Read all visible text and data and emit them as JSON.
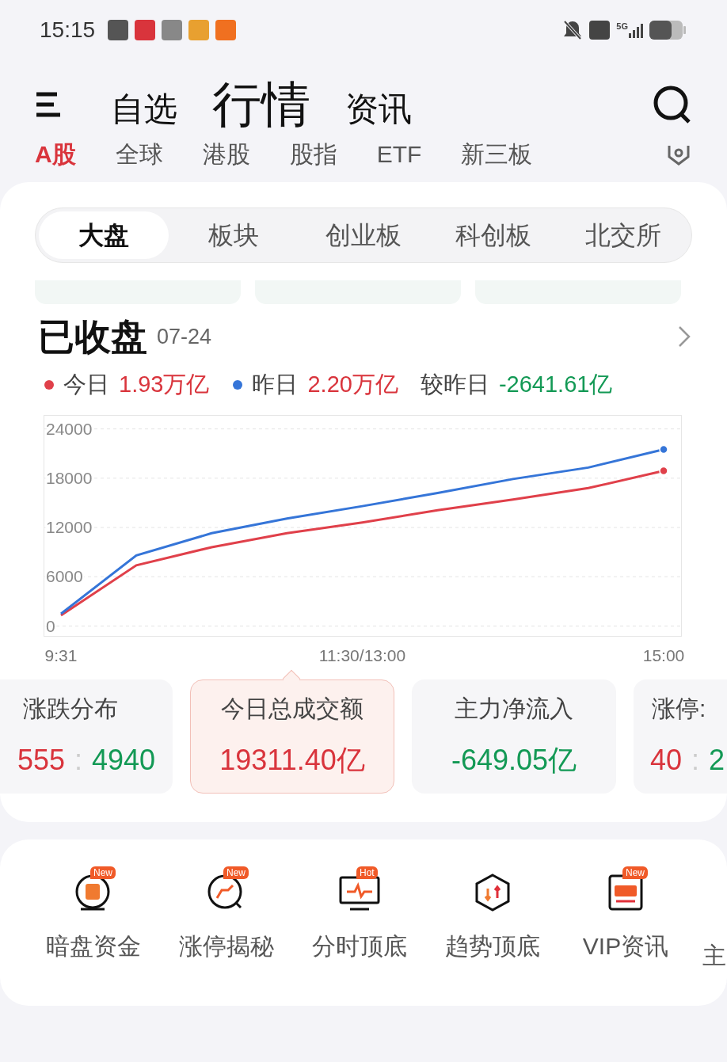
{
  "status_bar": {
    "time": "15:15",
    "network": "5G"
  },
  "top_tabs": [
    {
      "label": "自选",
      "selected": false
    },
    {
      "label": "行情",
      "selected": true
    },
    {
      "label": "资讯",
      "selected": false
    }
  ],
  "market_tabs": [
    {
      "label": "A股",
      "selected": true
    },
    {
      "label": "全球",
      "selected": false
    },
    {
      "label": "港股",
      "selected": false
    },
    {
      "label": "股指",
      "selected": false
    },
    {
      "label": "ETF",
      "selected": false
    },
    {
      "label": "新三板",
      "selected": false
    }
  ],
  "segments": [
    {
      "label": "大盘",
      "selected": true
    },
    {
      "label": "板块",
      "selected": false
    },
    {
      "label": "创业板",
      "selected": false
    },
    {
      "label": "科创板",
      "selected": false
    },
    {
      "label": "北交所",
      "selected": false
    }
  ],
  "summary": {
    "title": "已收盘",
    "date": "07-24",
    "today_value": "1.93万亿",
    "yesterday_value": "2.20万亿",
    "diff_label": "较昨日",
    "diff_value": "-2641.61亿"
  },
  "chart_data": {
    "type": "line",
    "grid": true,
    "categories": [
      "9:31",
      null,
      null,
      null,
      "11:30/13:00",
      null,
      null,
      null,
      "15:00"
    ],
    "ylim": [
      -1300,
      25700
    ],
    "yticks": [
      0,
      6000,
      12000,
      18000,
      24000
    ],
    "series": [
      {
        "name": "今日",
        "color": "#e0404a",
        "values": [
          1300,
          7400,
          9600,
          11300,
          12600,
          14100,
          15400,
          16800,
          18900
        ]
      },
      {
        "name": "昨日",
        "color": "#3575d8",
        "values": [
          1500,
          8600,
          11300,
          13100,
          14600,
          16200,
          17900,
          19300,
          21500
        ]
      }
    ]
  },
  "cards": [
    {
      "title": "涨跌分布",
      "kind": "ratio",
      "up": "555",
      "separator": ":",
      "down": "4940",
      "selected": false
    },
    {
      "title": "今日总成交额",
      "kind": "value",
      "value": "19311.40亿",
      "color": "#d9343c",
      "selected": true
    },
    {
      "title": "主力净流入",
      "kind": "value",
      "value": "-649.05亿",
      "color": "#139955",
      "selected": false
    },
    {
      "title": "涨停:",
      "kind": "ratio",
      "up": "40",
      "separator": ":",
      "down": "2",
      "selected": false
    }
  ],
  "tools": [
    {
      "label": "暗盘资金",
      "badge": "New",
      "kind": "dark"
    },
    {
      "label": "涨停揭秘",
      "badge": "New",
      "kind": "search"
    },
    {
      "label": "分时顶底",
      "badge": "Hot",
      "kind": "monitor"
    },
    {
      "label": "趋势顶底",
      "kind": "hexagon"
    },
    {
      "label": "VIP资讯",
      "badge": "New",
      "kind": "vip"
    },
    {
      "label": "主",
      "kind": "none"
    }
  ]
}
